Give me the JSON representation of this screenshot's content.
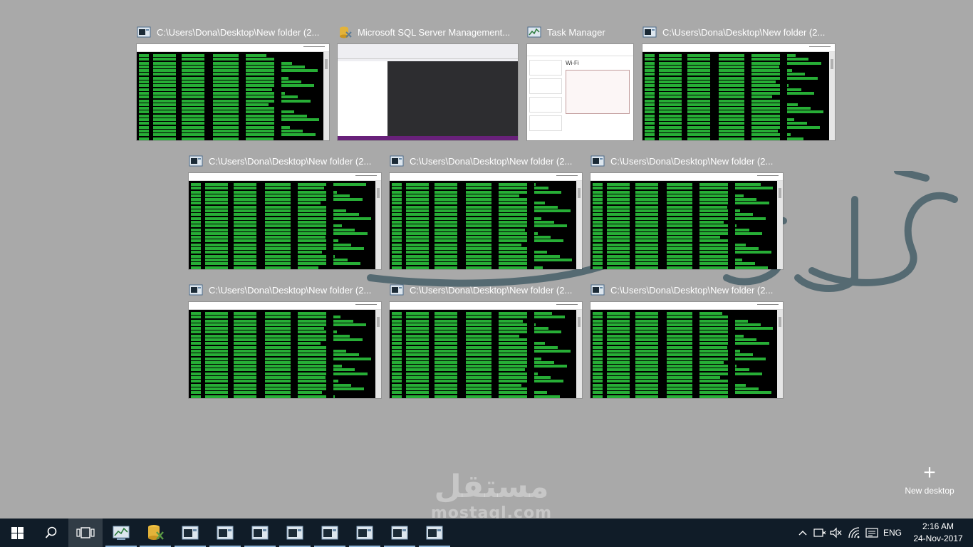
{
  "windows": [
    {
      "title": "C:\\Users\\Dona\\Desktop\\New folder (2...",
      "kind": "console",
      "icon": "console-icon"
    },
    {
      "title": "Microsoft SQL Server Management...",
      "kind": "ssms",
      "icon": "ssms-icon"
    },
    {
      "title": "Task Manager",
      "kind": "taskmgr",
      "icon": "task-manager-icon"
    },
    {
      "title": "C:\\Users\\Dona\\Desktop\\New folder (2...",
      "kind": "console",
      "icon": "console-icon"
    },
    {
      "title": "C:\\Users\\Dona\\Desktop\\New folder (2...",
      "kind": "console",
      "icon": "console-icon"
    },
    {
      "title": "C:\\Users\\Dona\\Desktop\\New folder (2...",
      "kind": "console",
      "icon": "console-icon"
    },
    {
      "title": "C:\\Users\\Dona\\Desktop\\New folder (2...",
      "kind": "console",
      "icon": "console-icon"
    },
    {
      "title": "C:\\Users\\Dona\\Desktop\\New folder (2...",
      "kind": "console",
      "icon": "console-icon"
    },
    {
      "title": "C:\\Users\\Dona\\Desktop\\New folder (2...",
      "kind": "console",
      "icon": "console-icon"
    },
    {
      "title": "C:\\Users\\Dona\\Desktop\\New folder (2...",
      "kind": "console",
      "icon": "console-icon"
    }
  ],
  "new_desktop": {
    "label": "New desktop"
  },
  "watermark": {
    "arabic": "مستقل",
    "latin": "mostaql.com"
  },
  "taskbar": {
    "start_icon": "windows-start-icon",
    "search_icon": "search-icon",
    "taskview_icon": "task-view-icon",
    "apps": [
      "task-manager-icon",
      "ssms-icon",
      "console-icon",
      "console-icon",
      "console-icon",
      "console-icon",
      "console-icon",
      "console-icon",
      "console-icon",
      "console-icon"
    ],
    "language": "ENG",
    "time": "2:16 AM",
    "date": "24-Nov-2017"
  },
  "colors": {
    "taskbar": "#101c28",
    "overlay": "#a9a9a9",
    "console_text": "#2ecc40"
  }
}
